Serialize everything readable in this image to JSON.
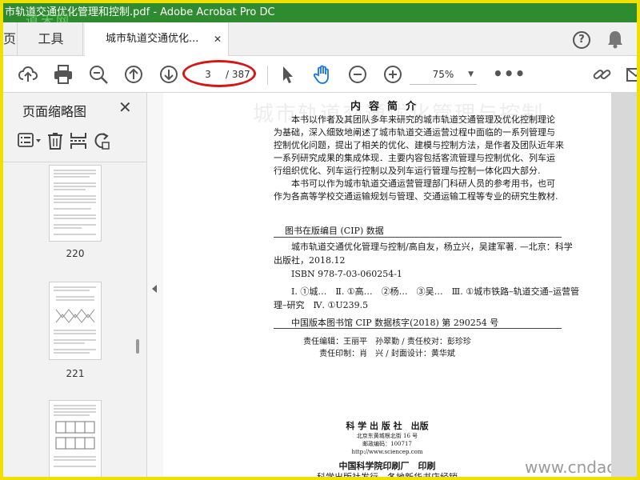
{
  "window": {
    "title": "市轨道交通优化管理和控制.pdf - Adobe Acrobat Pro DC",
    "watermark": "道禾网"
  },
  "tabs": {
    "home_label": "页",
    "tools_label": "工具",
    "doc_label": "城市轨道交通优化...",
    "close_glyph": "✕",
    "help_glyph": "?"
  },
  "toolbar": {
    "page_current": "3",
    "page_total": "/ 387",
    "zoom": "75%",
    "zoom_caret": "▼",
    "more_glyph": "•••"
  },
  "sidebar": {
    "title": "页面缩略图",
    "close_glyph": "✕",
    "thumbnails": [
      {
        "label": "220"
      },
      {
        "label": "221"
      },
      {
        "label": ""
      }
    ]
  },
  "document": {
    "ghost_title": "城市轨道交通优化管理与控制",
    "section_title": "内容简介",
    "paragraph_lines": [
      "　　本书以作者及其团队多年来研究的城市轨道交通管理及优化控制理论",
      "为基础，深入细致地阐述了城市轨道交通运营过程中面临的一系列管理与",
      "控制优化问题，提出了相关的优化、建模与控制方法，是作者及团队近年来",
      "一系列研究成果的集成体现．主要内容包括客流管理与控制优化、列车运",
      "行组织优化、列车运行控制以及列车运行管理与控制一体化四大部分.",
      "　　本书可以作为城市轨道交通运营管理部门科研人员的参考用书，也可",
      "作为各高等学校交通运输规划与管理、交通运输工程等专业的研究生教材."
    ],
    "cip_heading": "图书在版编目 (CIP) 数据",
    "cip_lines": [
      "　　城市轨道交通优化管理与控制/高自友，杨立兴，吴建军著. —北京：科学",
      "出版社，2018.12",
      "　　ISBN 978-7-03-060254-1",
      "",
      "　　Ⅰ. ①城…　Ⅱ. ①高…　②杨…　③吴…　Ⅲ. ①城市铁路–轨道交通–运营管",
      "理–研究　Ⅳ. ①U239.5",
      "",
      "　　中国版本图书馆 CIP 数据核字(2018) 第 290254 号"
    ],
    "credit_line1": "责任编辑：王丽平　孙翠勤 / 责任校对：彭珍珍",
    "credit_line2": "责任印制：肖　兴 / 封面设计：黄华斌",
    "publisher_name": "科 学 出 版 社　出版",
    "publisher_address": "北京东黄城根北街 16 号",
    "publisher_zip": "邮政编码：100717",
    "publisher_url": "http://www.sciencep.com",
    "printer": "中国科学院印刷厂　印刷",
    "distributor": "科学出版社发行　各地新华书店经销",
    "site_watermark": "www.cndao.c"
  }
}
